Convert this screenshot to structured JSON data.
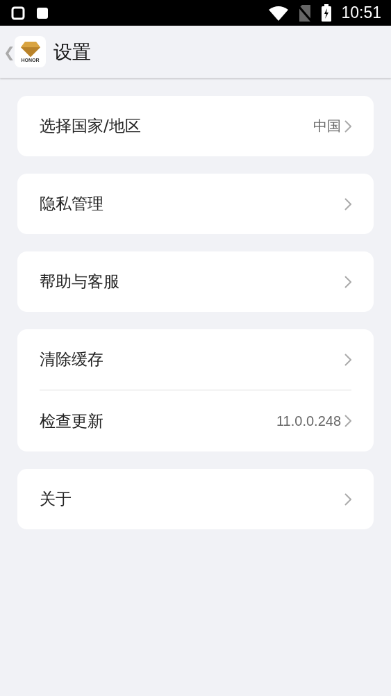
{
  "status_bar": {
    "time": "10:51"
  },
  "header": {
    "back": "❮",
    "app_icon_label": "HONOR",
    "title": "设置"
  },
  "groups": [
    {
      "items": [
        {
          "label": "选择国家/地区",
          "value": "中国"
        }
      ]
    },
    {
      "items": [
        {
          "label": "隐私管理"
        }
      ]
    },
    {
      "items": [
        {
          "label": "帮助与客服"
        }
      ]
    },
    {
      "items": [
        {
          "label": "清除缓存"
        },
        {
          "label": "检查更新",
          "value": "11.0.0.248"
        }
      ]
    },
    {
      "items": [
        {
          "label": "关于"
        }
      ]
    }
  ]
}
